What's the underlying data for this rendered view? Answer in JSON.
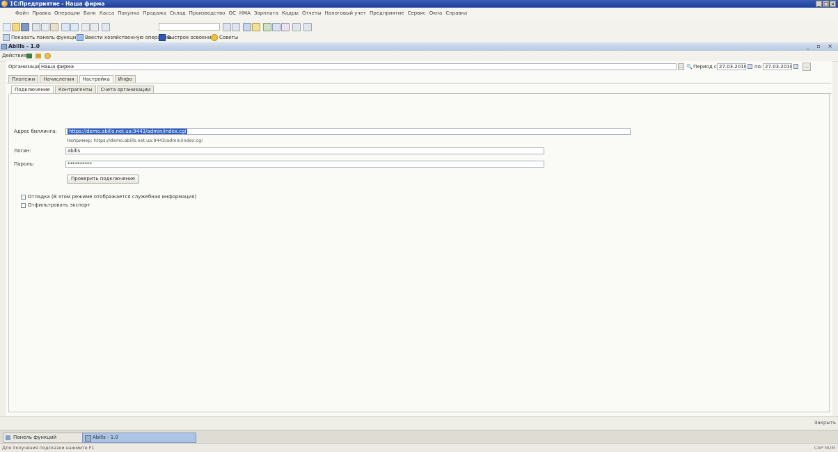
{
  "window": {
    "title": "1С:Предприятие - Наша фирма",
    "controls": [
      "_",
      "□",
      "×"
    ]
  },
  "menu": {
    "items": [
      "Файл",
      "Правка",
      "Операции",
      "Банк",
      "Касса",
      "Покупка",
      "Продажа",
      "Склад",
      "Производство",
      "ОС",
      "НМА",
      "Зарплата",
      "Кадры",
      "Отчеты",
      "Налоговый учет",
      "Предприятие",
      "Сервис",
      "Окна",
      "Справка"
    ]
  },
  "toolbar2": {
    "show_functions_label": "Показать панель функций",
    "enter_operations_label": "Ввести хозяйственную операцию",
    "quick_learning_label": "Быстрое освоение",
    "tips_label": "Советы"
  },
  "doc_window": {
    "title": "Abills - 1.0",
    "controls": "_ ▫ ×"
  },
  "actions": {
    "label": "Действия ▾"
  },
  "form": {
    "org_label": "Организация:",
    "org_value": "Наша фирма",
    "period_label": "Период с:",
    "period_from": "27.03.2018",
    "period_to_label": "по:",
    "period_to": "27.03.2018",
    "top_tabs": [
      "Платежи",
      "Начисления",
      "Настройка",
      "Инфо"
    ],
    "active_top_tab": "Настройка",
    "sub_tabs": [
      "Подключение",
      "Контрагенты",
      "Счета организации"
    ],
    "active_sub_tab": "Подключение",
    "address_label": "Адрес биллинга:",
    "address_value": "https://demo.abills.net.ua:9443/admin/index.cgi",
    "address_example": "Например: https://demo.abills.net.ua:9443/admin/index.cgi",
    "login_label": "Логин:",
    "login_value": "abills",
    "password_label": "Пароль:",
    "password_value": "**********",
    "check_button": "Проверить подключение",
    "debug_checkbox": "Отладка (В этом режиме отображается служебная информация)",
    "filter_checkbox": "Отфильтровать экспорт",
    "debug_checked": false,
    "filter_checked": false
  },
  "closebar": {
    "close_label": "Закрыть"
  },
  "taskbar": {
    "functions_panel": "Панель функций",
    "abills_window": "Abills - 1.0"
  },
  "status": {
    "hint": "Для получения подсказки нажмите F1",
    "indicators": "CAP NUM"
  },
  "colors": {
    "title_bar": "#1d3f98",
    "selection": "#2f5fc7",
    "active_task": "#aec4e4"
  }
}
